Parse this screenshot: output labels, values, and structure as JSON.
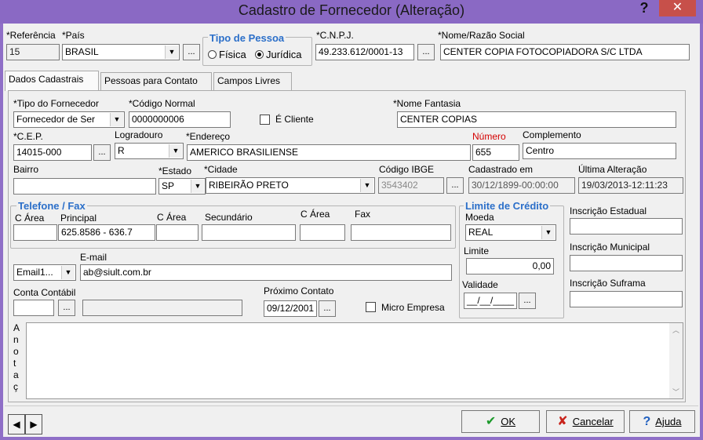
{
  "window": {
    "title": "Cadastro de Fornecedor (Alteração)",
    "help_glyph": "?",
    "close_glyph": "✕"
  },
  "header": {
    "referencia_label": "*Referência",
    "referencia_value": "15",
    "pais_label": "*País",
    "pais_value": "BRASIL",
    "tipo_pessoa_title": "Tipo de Pessoa",
    "fisica_label": "Física",
    "juridica_label": "Jurídica",
    "cnpj_label": "*C.N.P.J.",
    "cnpj_value": "49.233.612/0001-13",
    "razao_label": "*Nome/Razão Social",
    "razao_value": "CENTER COPIA FOTOCOPIADORA S/C LTDA"
  },
  "tabs": [
    "Dados Cadastrais",
    "Pessoas para Contato",
    "Campos Livres"
  ],
  "form": {
    "tipo_fornecedor_label": "*Tipo do Fornecedor",
    "tipo_fornecedor_value": "Fornecedor de Ser",
    "codigo_normal_label": "*Código Normal",
    "codigo_normal_value": "0000000006",
    "e_cliente_label": "É Cliente",
    "nome_fantasia_label": "*Nome Fantasia",
    "nome_fantasia_value": "CENTER COPIAS",
    "cep_label": "*C.E.P.",
    "cep_value": "14015-000",
    "logradouro_label": "Logradouro",
    "logradouro_value": "R",
    "endereco_label": "*Endereço",
    "endereco_value": "AMERICO BRASILIENSE",
    "numero_label": "Número",
    "numero_value": "655",
    "complemento_label": "Complemento",
    "complemento_value": "Centro",
    "bairro_label": "Bairro",
    "bairro_value": "",
    "estado_label": "*Estado",
    "estado_value": "SP",
    "cidade_label": "*Cidade",
    "cidade_value": "RIBEIRÃO PRETO",
    "ibge_label": "Código IBGE",
    "ibge_value": "3543402",
    "cadastrado_label": "Cadastrado em",
    "cadastrado_value": "30/12/1899-00:00:00",
    "alteracao_label": "Última Alteração",
    "alteracao_value": "19/03/2013-12:11:23",
    "telefone_title": "Telefone / Fax",
    "carea1_label": "C Área",
    "principal_label": "Principal",
    "principal_value": "625.8586 - 636.7",
    "carea2_label": "C Área",
    "secundario_label": "Secundário",
    "carea3_label": "C Área",
    "fax_label": "Fax",
    "limite_title": "Limite de Crédito",
    "moeda_label": "Moeda",
    "moeda_value": "REAL",
    "limite_label": "Limite",
    "limite_value": "0,00",
    "validade_label": "Validade",
    "validade_value": "__/__/____",
    "insc_estadual_label": "Inscrição Estadual",
    "insc_municipal_label": "Inscrição Municipal",
    "insc_suframa_label": "Inscrição Suframa",
    "email_type_value": "Email1...",
    "email_label": "E-mail",
    "email_value": "ab@siult.com.br",
    "conta_contabil_label": "Conta Contábil",
    "proximo_contato_label": "Próximo Contato",
    "proximo_contato_value": "09/12/2001",
    "micro_empresa_label": "Micro Empresa",
    "anotacoes_label": [
      "A",
      "n",
      "o",
      "t",
      "a",
      "ç"
    ]
  },
  "footer": {
    "prev_glyph": "◀",
    "next_glyph": "▶",
    "ok_label": "OK",
    "cancel_label": "Cancelar",
    "help_label": "Ajuda"
  }
}
